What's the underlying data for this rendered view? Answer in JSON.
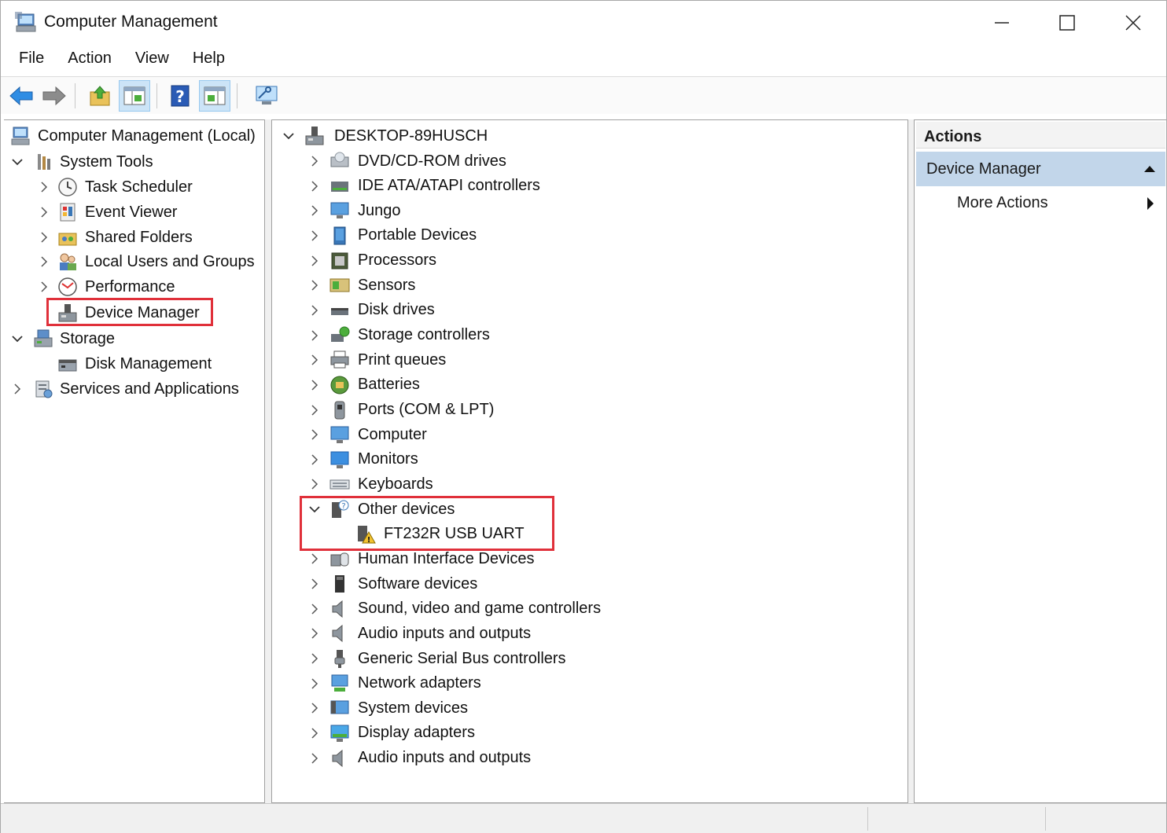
{
  "window": {
    "title": "Computer Management",
    "controls": {
      "minimize": "minimize-icon",
      "maximize": "maximize-icon",
      "close": "close-icon"
    }
  },
  "menu": [
    "File",
    "Action",
    "View",
    "Help"
  ],
  "toolbar": [
    "back-arrow-icon",
    "forward-arrow-icon",
    "up-folder-icon",
    "show-hide-console-tree-icon",
    "help-icon",
    "show-hide-action-pane-icon",
    "scan-hardware-icon"
  ],
  "left_tree": {
    "root": "Computer Management (Local)",
    "system_tools": "System Tools",
    "task_scheduler": "Task Scheduler",
    "event_viewer": "Event Viewer",
    "shared_folders": "Shared Folders",
    "local_users": "Local Users and Groups",
    "performance": "Performance",
    "device_manager": "Device Manager",
    "storage": "Storage",
    "disk_management": "Disk Management",
    "services": "Services and Applications"
  },
  "device_tree": {
    "computer_name": "DESKTOP-89HUSCH",
    "categories": [
      "DVD/CD-ROM drives",
      "IDE ATA/ATAPI controllers",
      "Jungo",
      "Portable Devices",
      "Processors",
      "Sensors",
      "Disk drives",
      "Storage controllers",
      "Print queues",
      "Batteries",
      "Ports (COM & LPT)",
      "Computer",
      "Monitors",
      "Keyboards",
      "Other devices",
      "FT232R USB UART",
      "Human Interface Devices",
      "Software devices",
      "Sound, video and game controllers",
      "Audio inputs and outputs",
      "Generic Serial Bus controllers",
      "Network adapters",
      "System devices",
      "Display adapters",
      "Audio inputs and outputs"
    ]
  },
  "actions": {
    "header": "Actions",
    "selected": "Device Manager",
    "more": "More Actions"
  },
  "colors": {
    "highlight_border": "#e0303a",
    "actions_selected_bg": "#c2d6ea"
  }
}
